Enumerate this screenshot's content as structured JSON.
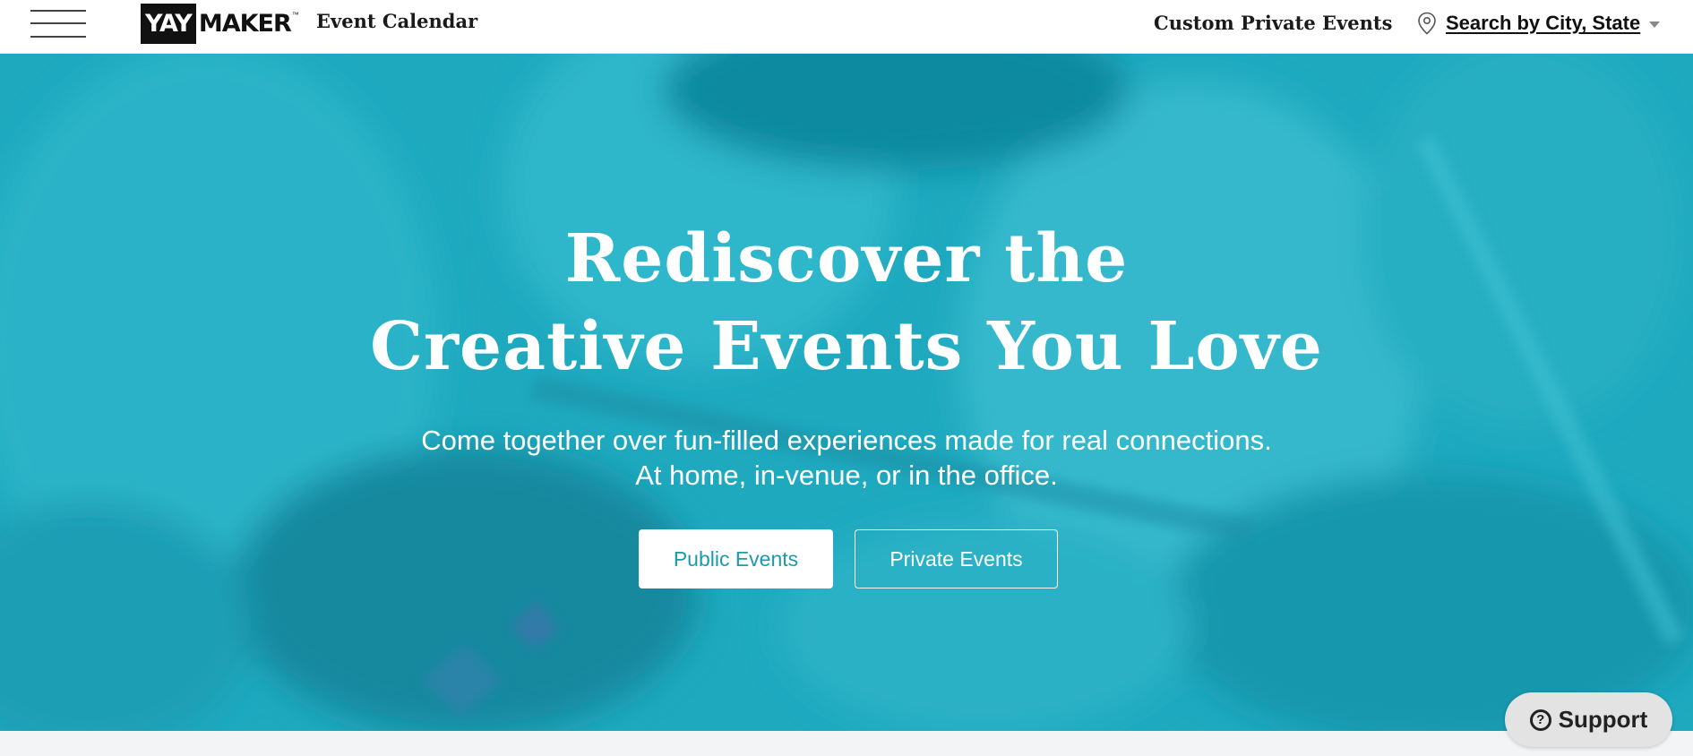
{
  "header": {
    "logo_box_text": "YAY",
    "logo_rest_text": "MAKER",
    "logo_tm": "™",
    "event_calendar_label": "Event Calendar",
    "custom_private_label": "Custom Private Events",
    "location_label": "Search by City, State"
  },
  "hero": {
    "title_line1": "Rediscover the",
    "title_line2": "Creative Events You Love",
    "subtitle_line1": "Come together over fun-filled experiences made for real connections.",
    "subtitle_line2": "At home, in-venue, or in the office.",
    "public_button_label": "Public Events",
    "private_button_label": "Private Events"
  },
  "support": {
    "icon_glyph": "?",
    "label": "Support"
  },
  "colors": {
    "hero_overlay": "#1aa7bd",
    "header_bg": "#ffffff",
    "button_text_teal": "#1b9ab0",
    "support_bg": "#e3e3e3"
  },
  "icons": {
    "menu": "hamburger-menu-icon",
    "location": "map-pin-icon",
    "dropdown": "caret-down-icon",
    "support": "question-circle-icon"
  }
}
